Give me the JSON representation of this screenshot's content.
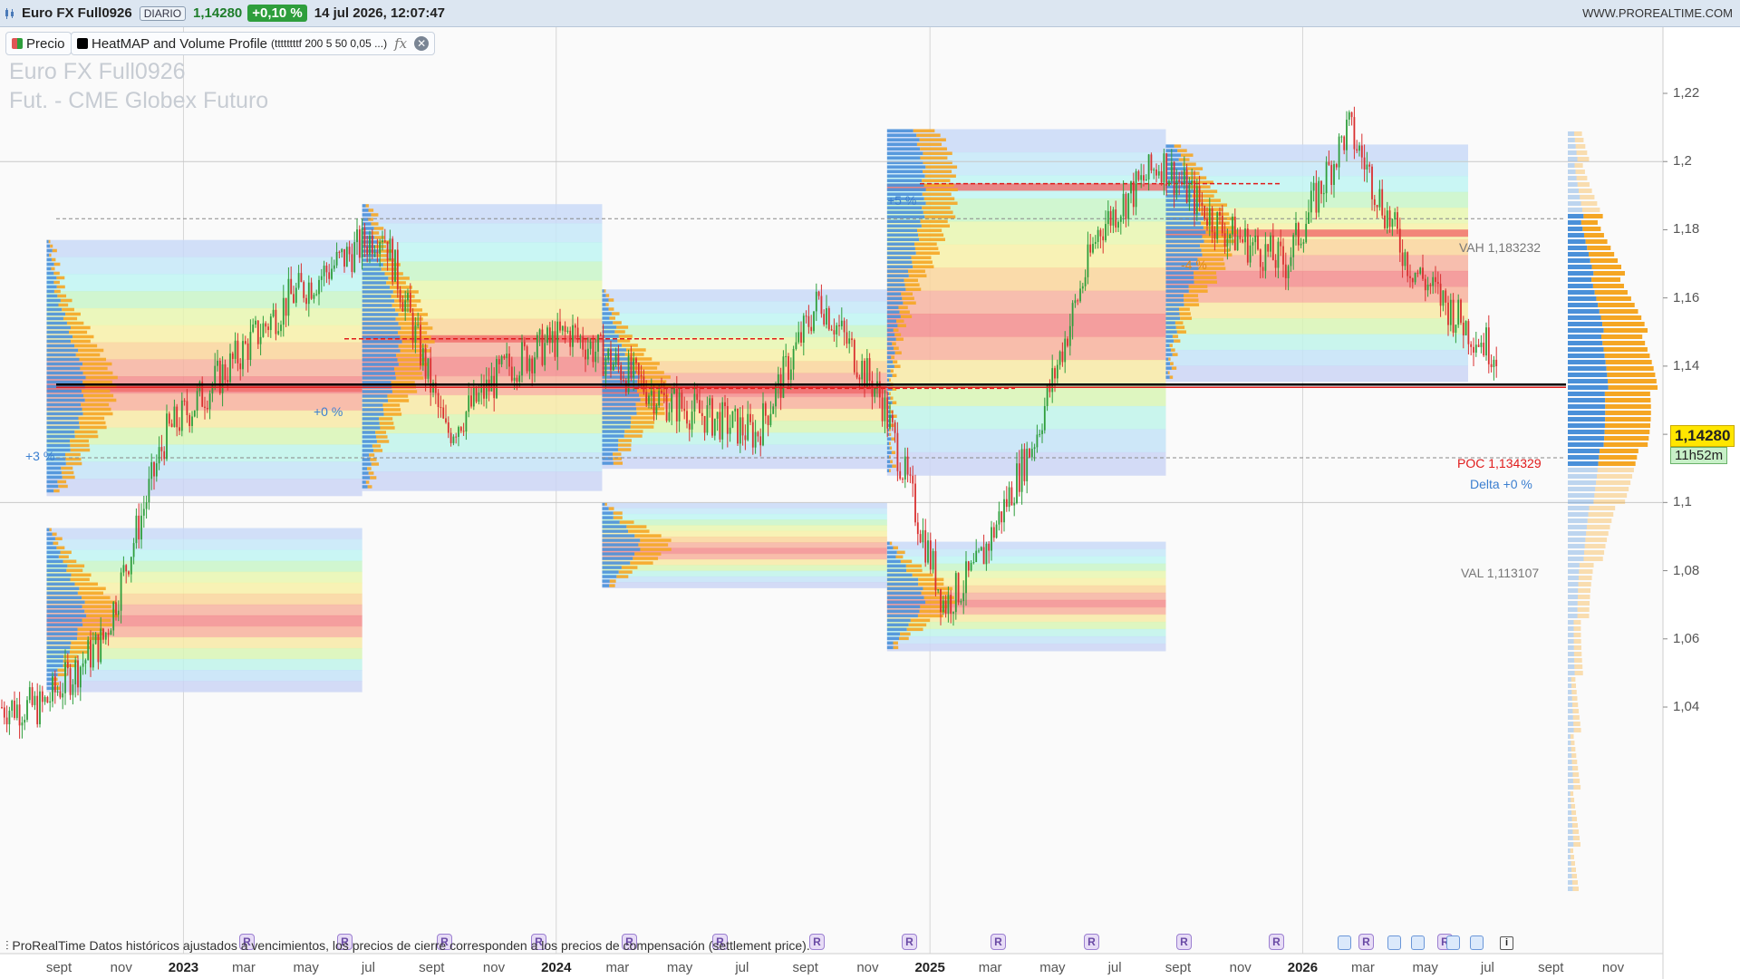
{
  "header": {
    "symbol": "Euro FX Full0926",
    "period": "DIARIO",
    "last": "1,14280",
    "change": "+0,10 %",
    "datetime": "14 jul 2026, 12:07:47",
    "site": "WWW.PROREALTIME.COM"
  },
  "indicators": [
    {
      "label": "Precio",
      "color": "#e05555"
    },
    {
      "label": "HeatMAP and Volume Profile",
      "params": "(ttttttttf 200 5 50 0,05 ...)",
      "color": "#000000"
    }
  ],
  "watermark": {
    "line1": "Euro FX Full0926",
    "line2": "Fut. - CME Globex  Futuro"
  },
  "price_axis": {
    "ticks": [
      "1,22",
      "1,2",
      "1,18",
      "1,16",
      "1,14",
      "1,12",
      "1,1",
      "1,08",
      "1,06",
      "1,04"
    ],
    "last_price": "1,14280",
    "countdown": "11h52m"
  },
  "time_axis": {
    "labels": [
      {
        "t": "sept",
        "year": false
      },
      {
        "t": "nov",
        "year": false
      },
      {
        "t": "2023",
        "year": true
      },
      {
        "t": "mar",
        "year": false
      },
      {
        "t": "may",
        "year": false
      },
      {
        "t": "jul",
        "year": false
      },
      {
        "t": "sept",
        "year": false
      },
      {
        "t": "nov",
        "year": false
      },
      {
        "t": "2024",
        "year": true
      },
      {
        "t": "mar",
        "year": false
      },
      {
        "t": "may",
        "year": false
      },
      {
        "t": "jul",
        "year": false
      },
      {
        "t": "sept",
        "year": false
      },
      {
        "t": "nov",
        "year": false
      },
      {
        "t": "2025",
        "year": true
      },
      {
        "t": "mar",
        "year": false
      },
      {
        "t": "may",
        "year": false
      },
      {
        "t": "jul",
        "year": false
      },
      {
        "t": "sept",
        "year": false
      },
      {
        "t": "nov",
        "year": false
      },
      {
        "t": "2026",
        "year": true
      },
      {
        "t": "mar",
        "year": false
      },
      {
        "t": "may",
        "year": false
      },
      {
        "t": "jul",
        "year": false
      },
      {
        "t": "sept",
        "year": false
      },
      {
        "t": "nov",
        "year": false
      }
    ]
  },
  "annotations": {
    "vah": "VAH 1,183232",
    "val": "VAL 1,113107",
    "poc": "POC 1,134329",
    "delta": "Delta +0 %",
    "period_deltas": [
      "+3 %",
      "+0 %",
      "+5 %",
      "-4 %"
    ]
  },
  "disclaimer": {
    "brand": "ProRealTime",
    "text": "Datos históricos ajustados a vencimientos, los precios de cierre corresponden a los precios de compensación (settlement price)."
  },
  "markers": {
    "r": "R",
    "i": "i"
  },
  "colors": {
    "up": "#2e9e3c",
    "down": "#d93030",
    "poc": "#e01b1b",
    "last_price_bg": "#ffe600",
    "ask_volume": "#4a90d9",
    "bid_volume": "#f5a623"
  },
  "chart_data": {
    "type": "candlestick",
    "title": "Euro FX Full0926",
    "timeframe": "daily",
    "ylim": [
      1.03,
      1.225
    ],
    "x_range": [
      "2022-08",
      "2026-11"
    ],
    "value_area": {
      "vah": 1.183232,
      "val": 1.113107,
      "poc": 1.134329
    },
    "last_close": 1.1428,
    "price_path": [
      {
        "date": "2022-08",
        "close": 1.04
      },
      {
        "date": "2022-10",
        "close": 1.06
      },
      {
        "date": "2022-12",
        "close": 1.12
      },
      {
        "date": "2023-02",
        "close": 1.14
      },
      {
        "date": "2023-04",
        "close": 1.16
      },
      {
        "date": "2023-07",
        "close": 1.18
      },
      {
        "date": "2023-09",
        "close": 1.12
      },
      {
        "date": "2023-11",
        "close": 1.14
      },
      {
        "date": "2024-01",
        "close": 1.15
      },
      {
        "date": "2024-04",
        "close": 1.13
      },
      {
        "date": "2024-07",
        "close": 1.12
      },
      {
        "date": "2024-09",
        "close": 1.16
      },
      {
        "date": "2024-11",
        "close": 1.13
      },
      {
        "date": "2025-01",
        "close": 1.07
      },
      {
        "date": "2025-02",
        "close": 1.08
      },
      {
        "date": "2025-04",
        "close": 1.12
      },
      {
        "date": "2025-06",
        "close": 1.18
      },
      {
        "date": "2025-08",
        "close": 1.2
      },
      {
        "date": "2025-10",
        "close": 1.18
      },
      {
        "date": "2025-12",
        "close": 1.17
      },
      {
        "date": "2026-02",
        "close": 1.21
      },
      {
        "date": "2026-04",
        "close": 1.17
      },
      {
        "date": "2026-06",
        "close": 1.15
      },
      {
        "date": "2026-07",
        "close": 1.1428
      }
    ]
  }
}
